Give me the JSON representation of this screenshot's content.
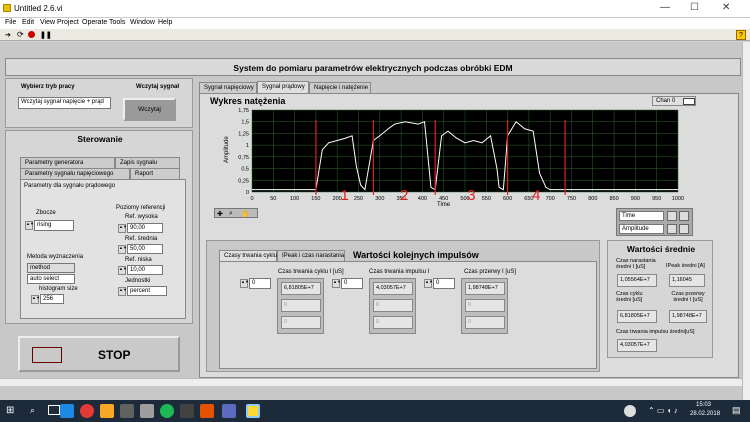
{
  "window": {
    "title": "Untitled 2.6.vi",
    "minimize": "—",
    "maximize": "☐",
    "close": "✕"
  },
  "menu": [
    "File",
    "Edit",
    "View",
    "Project",
    "Operate",
    "Tools",
    "Window",
    "Help"
  ],
  "header": {
    "title": "System do pomiaru parametrów elektrycznych podczas obróbki EDM"
  },
  "left": {
    "work_mode_label": "Wybierz tryb pracy",
    "work_mode_value": "Wczytaj sygnał napięcie + prąd",
    "load_label": "Wczytaj sygnał",
    "load_button": "Wczytaj",
    "control_title": "Sterowanie",
    "tabs": [
      "Parametry generatora",
      "Zapis sygnału",
      "Parametry sygnału napięciowego",
      "Raport"
    ],
    "subtitle": "Parametry dla sygnału prądowego",
    "edge_label": "Zbocze",
    "edge_value": "rising",
    "method_label": "Metoda wyznaczenia",
    "method_head": "method",
    "method_value": "auto select",
    "hist_label": "histogram size",
    "hist_value": "256",
    "ref_title": "Poziomy referencji",
    "ref_high_label": "Ref. wysoka",
    "ref_high_value": "90,00",
    "ref_mid_label": "Ref. średnia",
    "ref_mid_value": "50,00",
    "ref_low_label": "Ref. niska",
    "ref_low_value": "10,00",
    "units_label": "Jednostki",
    "units_value": "percent",
    "stop_label": "STOP"
  },
  "main_tabs": [
    "Sygnał napięciowy",
    "Sygnał prądowy",
    "Napięcie i natężenie"
  ],
  "graph": {
    "title": "Wykres natężenia",
    "channel": "Chan 0",
    "legend_time": "Time",
    "legend_amp": "Amplitude"
  },
  "chart_data": {
    "type": "line",
    "title": "Wykres natężenia",
    "xlabel": "Time",
    "ylabel": "Amplitude",
    "xlim": [
      0,
      1000
    ],
    "ylim": [
      0,
      1.75
    ],
    "xticks": [
      "0",
      "50",
      "100",
      "150",
      "200",
      "250",
      "300",
      "350",
      "400",
      "450",
      "500",
      "550",
      "600",
      "650",
      "700",
      "750",
      "800",
      "850",
      "900",
      "950",
      "1000"
    ],
    "yticks": [
      "0",
      "0,25",
      "0,5",
      "0,75",
      "1",
      "1,25",
      "1,5",
      "1,75"
    ],
    "x": [
      0,
      150,
      165,
      180,
      200,
      220,
      235,
      245,
      255,
      265,
      285,
      300,
      320,
      335,
      360,
      390,
      405,
      420,
      430,
      445,
      460,
      480,
      500,
      520,
      540,
      560,
      575,
      580,
      590,
      600,
      620,
      640,
      660,
      675,
      690,
      700,
      1000
    ],
    "series": [
      {
        "values": [
          0.05,
          0.05,
          0.9,
          1.05,
          1.1,
          1.15,
          1.2,
          0.55,
          0.15,
          0.05,
          1.1,
          1.2,
          1.35,
          1.45,
          1.5,
          1.45,
          1.5,
          0.1,
          0.05,
          1.2,
          1.3,
          1.15,
          1.05,
          1.1,
          1.05,
          1.2,
          0.5,
          0.1,
          0.05,
          1.2,
          1.5,
          1.35,
          1.3,
          0.4,
          0.1,
          0.05,
          0.05
        ]
      }
    ],
    "markers_x": [
      150,
      285,
      430,
      600,
      735
    ],
    "annotations": [
      "1",
      "2",
      "3",
      "4"
    ],
    "grid": true
  },
  "bottom_tabs": [
    "Czasy trwania cyklu",
    "IPeak i czas narastania"
  ],
  "pulses": {
    "title": "Wartości kolejnych impulsów",
    "c1_label": "Czas trwania cyklu I [uS]",
    "c1_index": "0",
    "c1_values": [
      "6,81805E+7",
      "0",
      "0"
    ],
    "c2_label": "Czas trwania impulsu I",
    "c2_index": "0",
    "c2_values": [
      "4,03057E+7",
      "0",
      "0"
    ],
    "c3_label": "Czas przerwy I [uS]",
    "c3_index": "0",
    "c3_values": [
      "1,98748E+7",
      "0",
      "0"
    ]
  },
  "averages": {
    "title": "Wartości średnie",
    "rise_label": "Czas narastania średni I [uS]",
    "rise_value": "1,05564E+7",
    "ipeak_label": "IPeak średni [A]",
    "ipeak_value": "1,16045",
    "cycle_label": "Czas cyklu średni [uS]",
    "cycle_value": "6,81805E+7",
    "pause_label": "Czas przerwy średni I [uS]",
    "pause_value": "1,98748E+7",
    "pulse_label": "Czas trwania impulsu średni[uS]",
    "pulse_value": "4,03057E+7"
  },
  "taskbar": {
    "time": "15:03",
    "date": "28.02.2018"
  },
  "colors": {
    "stop_red": "#e8231c",
    "marker_red": "#e02020",
    "plot_bg": "#000000",
    "plot_line": "#ffffff",
    "grid": "#2a6a2a"
  }
}
